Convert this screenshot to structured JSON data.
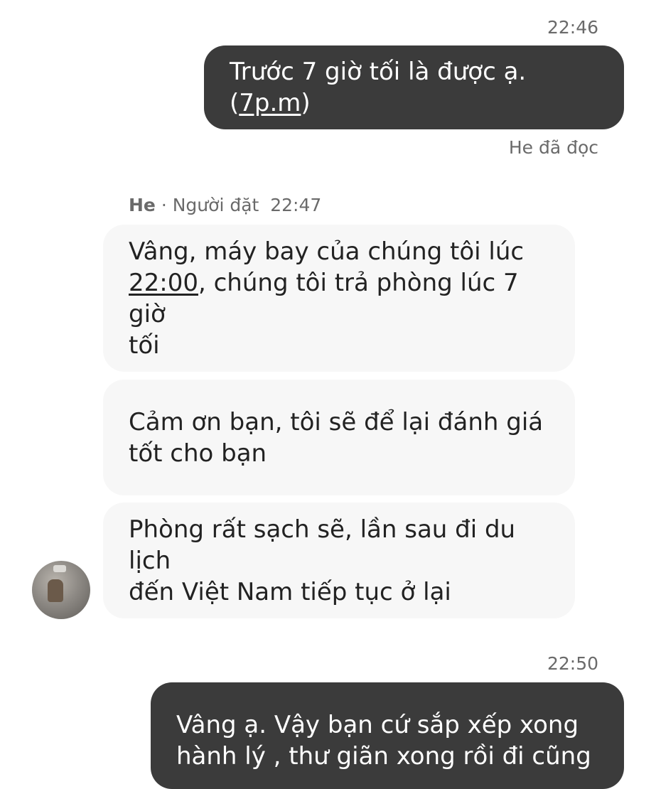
{
  "messages": {
    "msg1": {
      "time": "22:46",
      "text": "Trước 7 giờ tối  là được ạ. (",
      "link": "7p.m",
      "after": ")",
      "read_receipt": "He đã đọc"
    },
    "sender": {
      "name": "He",
      "role": " · Người đặt",
      "time": "22:47"
    },
    "msg2": {
      "line1": "Vâng, máy bay của chúng tôi lúc",
      "time_link": "22:00",
      "line2_rest": ", chúng tôi trả phòng lúc 7 giờ",
      "line3": "tối"
    },
    "msg3": {
      "line1": "Cảm ơn bạn, tôi sẽ để lại đánh giá",
      "line2": "tốt cho bạn"
    },
    "msg4": {
      "line1": "Phòng rất sạch sẽ, lần sau đi du lịch",
      "line2": "đến Việt Nam tiếp tục ở lại"
    },
    "msg5": {
      "time": "22:50",
      "line1": "Vâng ạ. Vậy bạn cứ sắp xếp xong",
      "line2": "hành lý , thư giãn xong rồi đi cũng"
    }
  },
  "avatar": {
    "icon": "user-photo-avatar"
  }
}
